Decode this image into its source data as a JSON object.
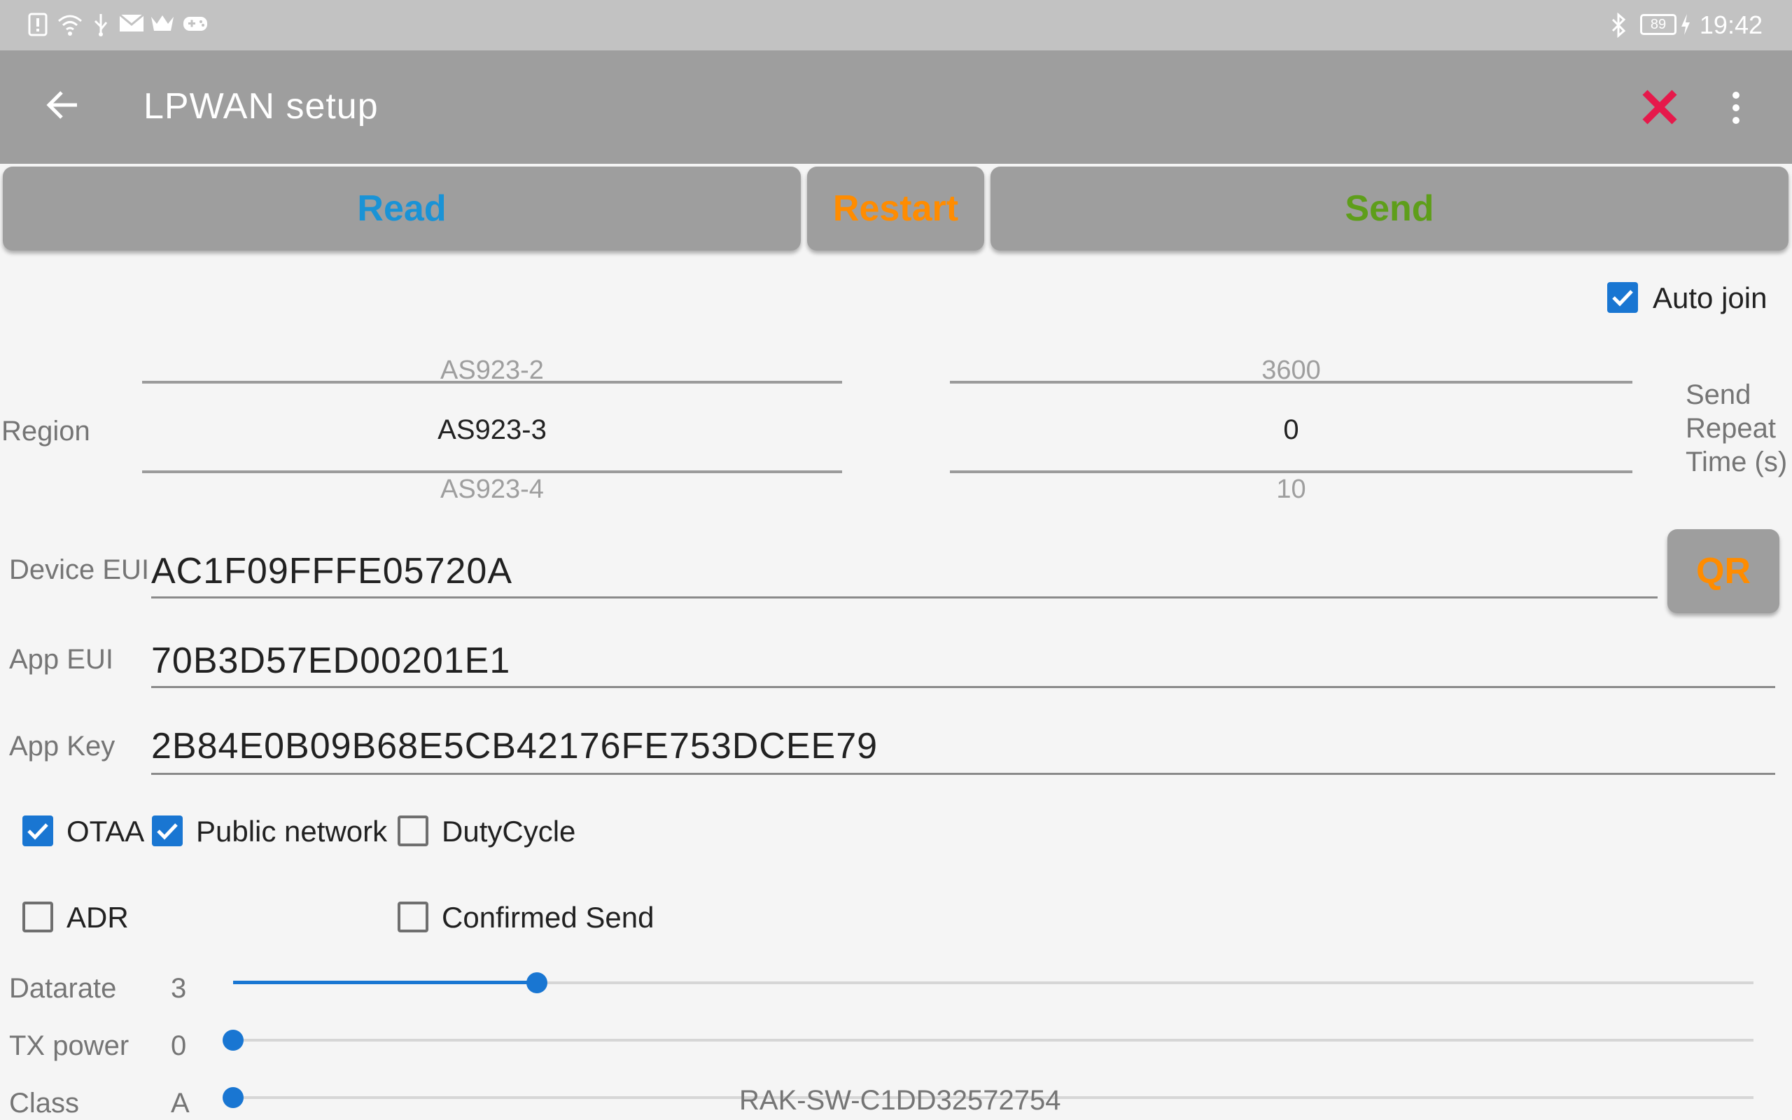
{
  "status_bar": {
    "time": "19:42",
    "battery": "89",
    "left_icons": [
      "notification-alert-icon",
      "wifi-icon",
      "usb-icon",
      "mail-icon",
      "crown-icon",
      "gamepad-icon"
    ],
    "right_icons": [
      "bluetooth-icon",
      "battery-icon",
      "charging-icon"
    ]
  },
  "app_bar": {
    "title": "LPWAN setup",
    "back_icon": "arrow-left-icon",
    "close_icon": "close-icon",
    "menu_icon": "more-vert-icon",
    "close_color": "#e6194b"
  },
  "actions": {
    "read": {
      "label": "Read",
      "color": "#1a93d6"
    },
    "restart": {
      "label": "Restart",
      "color": "#ff8c00"
    },
    "send": {
      "label": "Send",
      "color": "#5e9e1a"
    }
  },
  "auto_join": {
    "label": "Auto join",
    "checked": true
  },
  "region": {
    "label": "Region",
    "prev": "AS923-2",
    "selected": "AS923-3",
    "next": "AS923-4"
  },
  "send_repeat": {
    "label_line1": "Send",
    "label_line2": "Repeat",
    "label_line3": "Time (s)",
    "prev": "3600",
    "selected": "0",
    "next": "10"
  },
  "device_eui": {
    "label": "Device EUI",
    "value": "AC1F09FFFE05720A",
    "qr_label": "QR",
    "qr_color": "#ff8c00"
  },
  "app_eui": {
    "label": "App EUI",
    "value": "70B3D57ED00201E1"
  },
  "app_key": {
    "label": "App Key",
    "value": "2B84E0B09B68E5CB42176FE753DCEE79"
  },
  "options": {
    "otaa": {
      "label": "OTAA",
      "checked": true
    },
    "public_network": {
      "label": "Public network",
      "checked": true
    },
    "duty_cycle": {
      "label": "DutyCycle",
      "checked": false
    },
    "adr": {
      "label": "ADR",
      "checked": false
    },
    "confirmed_send": {
      "label": "Confirmed Send",
      "checked": false
    }
  },
  "datarate": {
    "label": "Datarate",
    "value": "3",
    "fraction": 0.2
  },
  "tx_power": {
    "label": "TX power",
    "value": "0",
    "fraction": 0.0
  },
  "class": {
    "label": "Class",
    "value": "A",
    "fraction": 0.0
  },
  "device_name": "RAK-SW-C1DD32572754"
}
